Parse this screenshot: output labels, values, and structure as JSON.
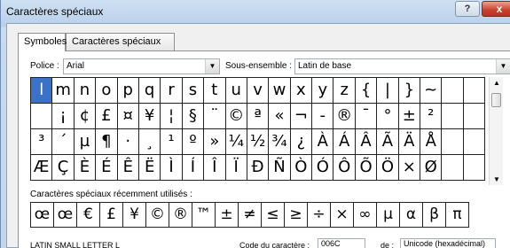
{
  "window": {
    "title": "Caractères spéciaux",
    "help_label": "?",
    "close_label": "x"
  },
  "tabs": [
    {
      "label": "Symboles",
      "active": true
    },
    {
      "label": "Caractères spéciaux",
      "active": false
    }
  ],
  "font": {
    "label": "Police :",
    "value": "Arial"
  },
  "subset": {
    "label": "Sous-ensemble :",
    "value": "Latin de base"
  },
  "symbol_grid": [
    [
      "",
      "m",
      "n",
      "o",
      "p",
      "q",
      "r",
      "s",
      "t",
      "u",
      "v",
      "w",
      "x",
      "y",
      "z",
      "{",
      "|",
      "}",
      "~"
    ],
    [
      "",
      "¡",
      "¢",
      "£",
      "¤",
      "¥",
      "¦",
      "§",
      "¨",
      "©",
      "ª",
      "«",
      "¬",
      "-",
      "®",
      "¯",
      "°",
      "±",
      "²"
    ],
    [
      "³",
      "´",
      "µ",
      "¶",
      "·",
      "¸",
      "¹",
      "º",
      "»",
      "¼",
      "½",
      "¾",
      "¿",
      "À",
      "Á",
      "Â",
      "Ã",
      "Ä",
      "Å"
    ],
    [
      "Æ",
      "Ç",
      "È",
      "É",
      "Ê",
      "Ë",
      "Ì",
      "Í",
      "Î",
      "Ï",
      "Ð",
      "Ñ",
      "Ò",
      "Ó",
      "Ô",
      "Õ",
      "Ö",
      "×",
      "Ø"
    ]
  ],
  "recent": {
    "label": "Caractères spéciaux récemment utilisés :",
    "chars": [
      "œ",
      "œ",
      "€",
      "£",
      "¥",
      "©",
      "®",
      "™",
      "±",
      "≠",
      "≤",
      "≥",
      "÷",
      "×",
      "∞",
      "µ",
      "α",
      "β",
      "π"
    ]
  },
  "footer": {
    "char_name": "LATIN SMALL LETTER L",
    "code_label": "Code du caractère :",
    "code_value": "006C",
    "from_label": "de :",
    "from_value": "Unicode (hexadécimal)"
  },
  "icons": {
    "dropdown": "chevron-down-icon",
    "scroll_up": "arrow-up-icon",
    "scroll_down": "arrow-down-icon"
  }
}
